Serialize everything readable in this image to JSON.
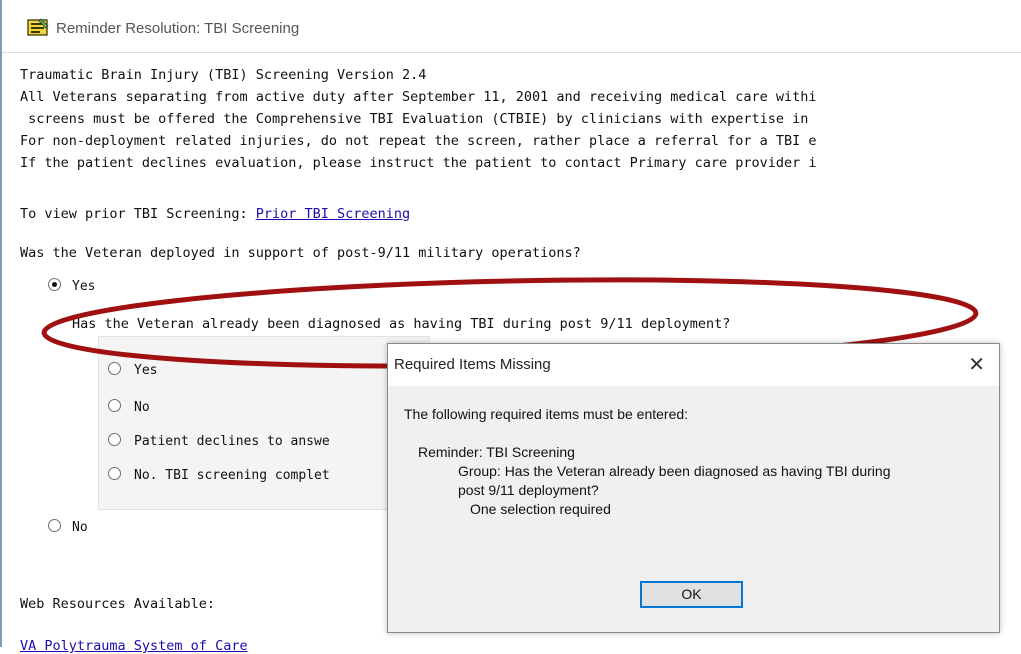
{
  "window": {
    "title": "Reminder Resolution: TBI Screening"
  },
  "content": {
    "header_lines": [
      "Traumatic Brain Injury (TBI) Screening Version 2.4",
      "All Veterans separating from active duty after September 11, 2001 and receiving medical care withi",
      " screens must be offered the Comprehensive TBI Evaluation (CTBIE) by clinicians with expertise in",
      "For non-deployment related injuries, do not repeat the screen, rather place a referral for a TBI e",
      "If the patient declines evaluation, please instruct the patient to contact Primary care provider i"
    ],
    "prior_prefix": "To view prior TBI Screening: ",
    "prior_link": "Prior TBI Screening",
    "deploy_question": "Was the Veteran deployed in support of post-9/11 military operations?",
    "deploy_yes": "Yes",
    "diag_question": "Has the Veteran already been diagnosed as having TBI during post 9/11 deployment?",
    "diag_options": [
      "Yes",
      "No",
      "Patient declines to answe",
      "No. TBI screening complet"
    ],
    "deploy_no": "No",
    "web_resources": "Web Resources Available:",
    "bottom_link": "VA Polytrauma System of Care"
  },
  "dialog": {
    "title": "Required Items Missing",
    "close": "✕",
    "message": "The following required items must be entered:",
    "reminder": "Reminder: TBI Screening",
    "group_line1": "Group: Has the Veteran already been diagnosed as having TBI during",
    "group_line2": "post 9/11 deployment?",
    "selection": "One selection required",
    "ok_label": "OK"
  },
  "colors": {
    "annotation_ellipse": "#a01010",
    "link": "#1a0dab",
    "button_focus": "#0078d7"
  }
}
